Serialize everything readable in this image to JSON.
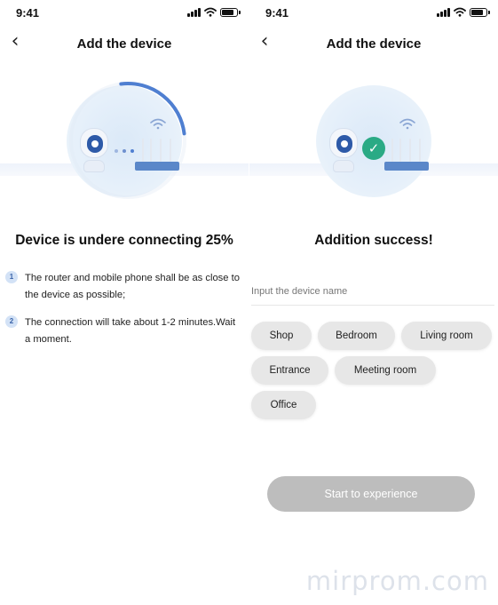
{
  "colors": {
    "accent_blue": "#4f7fd1",
    "progress_track": "#dfe8f4",
    "success_green": "#2aaa85",
    "tag_bg": "#e7e7e7",
    "button_disabled": "#bdbdbd",
    "dot_colors": [
      "#9fb7e0",
      "#6e90cf",
      "#4f7fd1"
    ]
  },
  "screens": {
    "connecting": {
      "status_time": "9:41",
      "title": "Add the device",
      "progress_percent": 25,
      "status": "Device is undere connecting 25%",
      "tips": [
        {
          "num": "1",
          "text": "The router and mobile phone shall be as close to the device as possible;"
        },
        {
          "num": "2",
          "text": "The connection will take about 1-2 minutes.Wait a moment."
        }
      ]
    },
    "success": {
      "status_time": "9:41",
      "title": "Add the device",
      "status": "Addition success!",
      "input_placeholder": "Input the device name",
      "input_value": "",
      "tags": [
        "Shop",
        "Bedroom",
        "Living room",
        "Entrance",
        "Meeting room",
        "Office"
      ],
      "button_label": "Start to experience"
    }
  },
  "watermark": "mirprom.com",
  "icons": {
    "back": "chevron-left-icon",
    "signal": "cellular-signal-icon",
    "wifi": "wifi-icon",
    "battery": "battery-icon",
    "camera": "camera-icon",
    "router": "router-icon",
    "check": "check-circle-icon"
  }
}
